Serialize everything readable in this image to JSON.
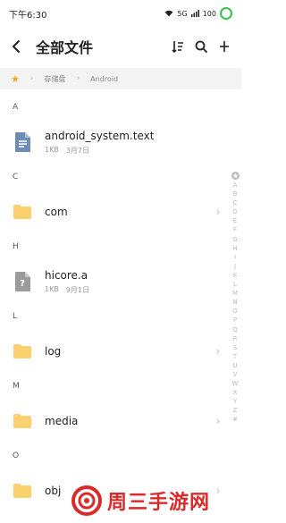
{
  "status": {
    "time": "下午6:30",
    "signal_text": "5G",
    "battery": "100"
  },
  "header": {
    "title": "全部文件"
  },
  "icons": {
    "back": "back-arrow-icon",
    "sort": "sort-icon",
    "search": "search-icon",
    "more": "more-vertical-icon"
  },
  "breadcrumb": {
    "items": [
      "存储盘",
      "Android"
    ]
  },
  "sections": [
    {
      "letter": "A",
      "items": [
        {
          "name": "android_system.text",
          "type": "document",
          "size": "1KB",
          "date": "3月7日"
        }
      ]
    },
    {
      "letter": "C",
      "items": [
        {
          "name": "com",
          "type": "folder"
        }
      ]
    },
    {
      "letter": "H",
      "items": [
        {
          "name": "hicore.a",
          "type": "unknown",
          "size": "1KB",
          "date": "9月1日"
        }
      ]
    },
    {
      "letter": "L",
      "items": [
        {
          "name": "log",
          "type": "folder"
        }
      ]
    },
    {
      "letter": "M",
      "items": [
        {
          "name": "media",
          "type": "folder"
        }
      ]
    },
    {
      "letter": "O",
      "items": [
        {
          "name": "obj",
          "type": "folder"
        }
      ]
    }
  ],
  "az_index": [
    "A",
    "B",
    "C",
    "D",
    "E",
    "F",
    "G",
    "H",
    "I",
    "J",
    "K",
    "L",
    "M",
    "N",
    "O",
    "P",
    "Q",
    "R",
    "S",
    "T",
    "U",
    "V",
    "W",
    "X",
    "Y",
    "Z",
    "#"
  ],
  "colors": {
    "folder": "#fbd06e",
    "doc": "#6d8db6",
    "unknown": "#9b9b9b",
    "accent": "#f5a623",
    "brand": "#d92a2a"
  },
  "watermark": {
    "text": "周三手游网"
  }
}
